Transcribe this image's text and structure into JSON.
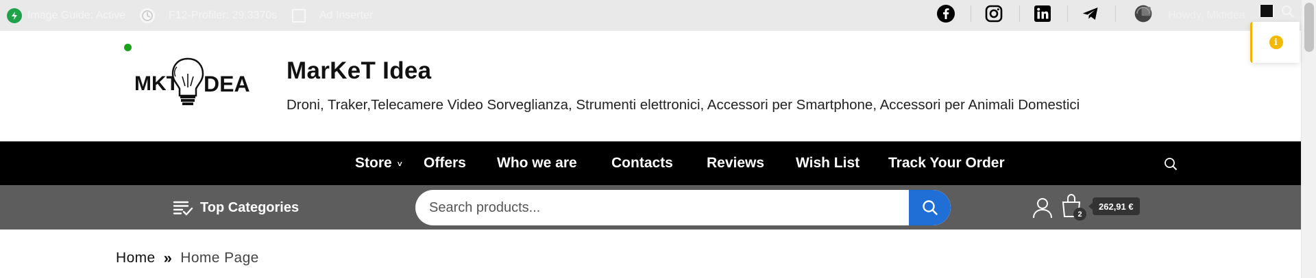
{
  "adminbar": {
    "items": [
      {
        "label": "Image Guide: Active",
        "icon": "bolt-icon"
      },
      {
        "label": "F12-Profiler: 29.3370s",
        "icon": "profiler-icon"
      },
      {
        "label": "Ad Inserter",
        "icon": "ad-inserter-icon"
      }
    ],
    "social": [
      "facebook-icon",
      "instagram-icon",
      "linkedin-icon",
      "telegram-icon"
    ],
    "howdy": "Howdy, Mktidea"
  },
  "header": {
    "logo_text_left": "MKT",
    "logo_text_right": "DEA",
    "title": "MarKeT Idea",
    "tagline": "Droni, Traker,Telecamere Video Sorveglianza, Strumenti elettronici, Accessori per Smartphone, Accessori per Animali Domestici"
  },
  "nav": {
    "items": [
      {
        "label": "Store",
        "has_caret": true
      },
      {
        "label": "Offers"
      },
      {
        "label": "Who we are"
      },
      {
        "label": "Contacts"
      },
      {
        "label": "Reviews"
      },
      {
        "label": "Wish List"
      },
      {
        "label": "Track Your Order"
      }
    ],
    "caret": "˅"
  },
  "catbar": {
    "categories_label": "Top Categories",
    "search_placeholder": "Search products...",
    "cart_count": "2",
    "cart_total": "262,91 €"
  },
  "breadcrumb": {
    "home": "Home",
    "separator": "»",
    "current": "Home Page"
  },
  "notice": {
    "symbol": "i"
  },
  "colors": {
    "nav_bg": "#000000",
    "catbar_bg": "#5d5d5d",
    "search_button": "#1f6fd6",
    "status_dot": "#1aa21a",
    "notice_accent": "#f5b800"
  }
}
